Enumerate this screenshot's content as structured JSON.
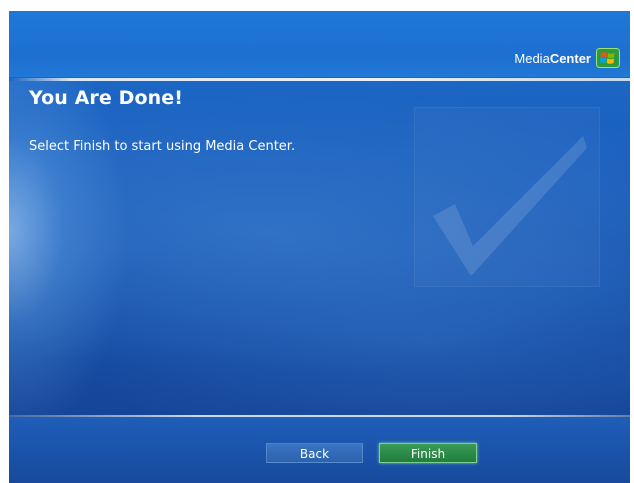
{
  "brand": {
    "name_light": "Media",
    "name_bold": "Center",
    "logo_icon": "windows-flag-icon"
  },
  "page": {
    "title": "You Are Done!",
    "instruction": "Select Finish to start using Media Center.",
    "watermark_icon": "checkmark-icon"
  },
  "buttons": {
    "back_label": "Back",
    "finish_label": "Finish"
  },
  "colors": {
    "background_blue": "#1a5fbf",
    "finish_green": "#1e7e3b",
    "finish_border": "#7fd08f",
    "text": "#ffffff"
  }
}
